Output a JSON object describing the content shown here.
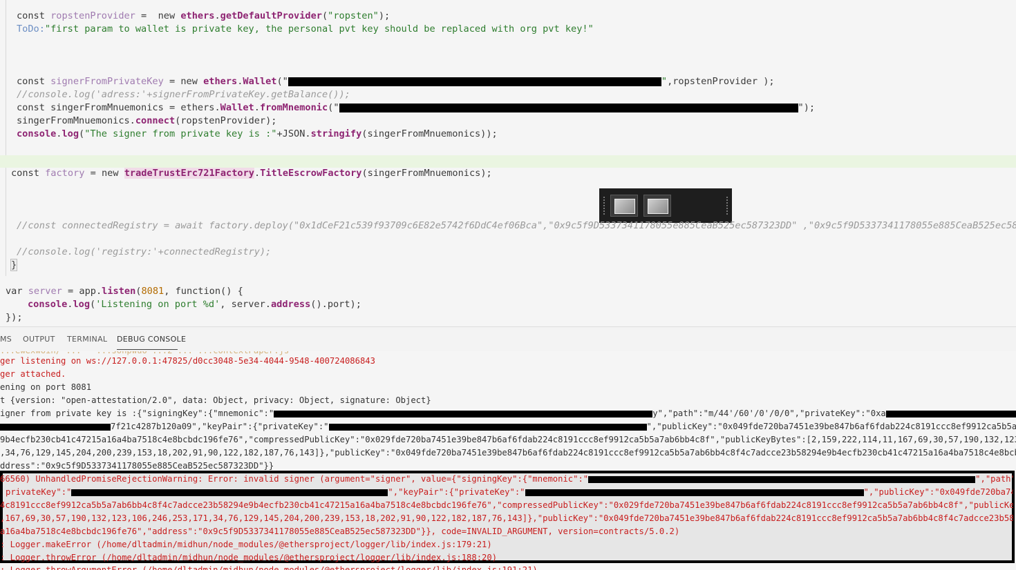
{
  "editor": {
    "line1": {
      "pre": "const ",
      "ident": "ropstenProvider",
      "mid": " =  new ",
      "obj": "ethers",
      "dot": ".",
      "fn": "getDefaultProvider",
      "open": "(",
      "str": "\"ropsten\"",
      "close": ");"
    },
    "line2": {
      "todo": "ToDo:",
      "str": "\"first param to wallet is private key, the personal pvt key should be replaced with org pvt key!\""
    },
    "line5": {
      "pre": "const ",
      "ident": "signerFromPrivateKey",
      "mid": " = new ",
      "obj": "ethers",
      "dot": ".",
      "fn": "Wallet",
      "open": "(\"",
      "str_end": "\"",
      "rest": ",ropstenProvider );"
    },
    "line6": {
      "cmt": "//console.log('adress:'+signerFromPrivateKey.getBalance());"
    },
    "line7": {
      "pre": "const singerFromMnuemonics = ethers.",
      "fn1": "Wallet",
      "dot": ".",
      "fn2": "fromMnemonic",
      "open": "(\"",
      "close": "\");"
    },
    "line8": {
      "pre": "singerFromMnuemonics.",
      "fn": "connect",
      "rest": "(ropstenProvider);"
    },
    "line9": {
      "obj": "console",
      "dot": ".",
      "fn": "log",
      "open": "(",
      "str": "\"The signer from private key is :\"",
      "mid": "+JSON.",
      "fn2": "stringify",
      "rest": "(singerFromMnuemonics));"
    },
    "line12": {
      "pre": "const ",
      "ident": "factory",
      "mid": " = new ",
      "hl": "tradeTrustErc721Factory",
      "dot": ".",
      "fn": "TitleEscrowFactory",
      "rest": "(singerFromMnuemonics);"
    },
    "line15": {
      "cmt": "//const connectedRegistry = await factory.deploy(\"0x1dCeF21c539f93709c6E82e5742f6DdC4ef06Bca\",\"0x9c5f9D5337341178055e885CeaB525ec587323DD\" ,\"0x9c5f9D5337341178055e885CeaB525ec587323DD\")"
    },
    "line17": {
      "cmt": "//console.log('registry:'+connectedRegistry);"
    },
    "line18": {
      "brace": "}"
    },
    "line19": {
      "pre": "var ",
      "ident": "server",
      "mid": " = app.",
      "fn": "listen",
      "open": "(",
      "num": "8081",
      "rest": ", function() {"
    },
    "line20": {
      "obj": "console",
      "dot": ".",
      "fn": "log",
      "open": "(",
      "str": "'Listening on port %d'",
      "mid": ", server.",
      "fn2": "address",
      "rest": "().port);"
    },
    "line21": {
      "text": "});"
    }
  },
  "panel": {
    "tabs": [
      "MS",
      "OUTPUT",
      "TERMINAL",
      "DEBUG CONSOLE"
    ],
    "active_tab": "DEBUG CONSOLE"
  },
  "console": {
    "top_partial": "...ewexwoin/ ...   ...sonpwuo ...2 ... ...contextPaper.js",
    "l1": "ger listening on ws://127.0.0.1:47825/d0cc3048-5e34-4044-9548-400724086843",
    "l2": "ger attached.",
    "l3": "ening on port 8081",
    "l4": "t {version: \"open-attestation/2.0\", data: Object, privacy: Object, signature: Object}",
    "l5a": "igner from private key is :{\"signingKey\":{\"mnemonic\":\"",
    "l5b": "y\",\"path\":\"m/44'/60'/0'/0/0\",\"privateKey\":\"0xa",
    "l6a": "7f21c4287b120a09\",\"keyPair\":{\"privateKey\":\"",
    "l6b": "\",\"publicKey\":\"0x049fde720ba7451e39be847b6af6fdab224c8191ccc8ef9912ca5b5a7ab6bb4c8f4c7adcce23",
    "l7": "9b4ecfb230cb41c47215a16a4ba7518c4e8bcbdc196fe76\",\"compressedPublicKey\":\"0x029fde720ba7451e39be847b6af6fdab224c8191ccc8ef9912ca5b5a7ab6bb4c8f\",\"publicKeyBytes\":[2,159,222,114,11,167,69,30,57,190,132,123,106,246,",
    "l8": ",34,76,129,145,204,200,239,153,18,202,91,90,122,182,187,76,143]},\"publicKey\":\"0x049fde720ba7451e39be847b6af6fdab224c8191ccc8ef9912ca5b5a7ab6bb4c8f4c7adcce23b58294e9b4ecfb230cb41c47215a16a4ba7518c4e8bcbdc196fe7",
    "l9": "ddress\":\"0x9c5f9D5337341178055e885CeaB525ec587323DD\"}}",
    "e1a": "66560) UnhandledPromiseRejectionWarning: Error: invalid signer (argument=\"signer\", value={\"signingKey\":{\"mnemonic\":\"",
    "e1b": "\",\"path\":\"m/44",
    "e2a": "privateKey\":\"",
    "e2b": "\",\"keyPair\":{\"privateKey\":\"",
    "e2c": "\",\"publicKey\":\"0x049fde720ba7451e39be",
    "e3": "4c8191ccc8ef9912ca5b5a7ab6bb4c8f4c7adcce23b58294e9b4ecfb230cb41c47215a16a4ba7518c4e8bcbdc196fe76\",\"compressedPublicKey\":\"0x029fde720ba7451e39be847b6af6fdab224c8191ccc8ef9912ca5b5a7ab6bb4c8f\",\"publicKeyBytes\":[2",
    "e4": ",167,69,30,57,190,132,123,106,246,253,171,34,76,129,145,204,200,239,153,18,202,91,90,122,182,187,76,143]},\"publicKey\":\"0x049fde720ba7451e39be847b6af6fdab224c8191ccc8ef9912ca5b5a7ab6bb4c8f4c7adcce23b58294e9b4e",
    "e5": "a16a4ba7518c4e8bcbdc196fe76\",\"address\":\"0x9c5f9D5337341178055e885CeaB525ec587323DD\"}}, code=INVALID_ARGUMENT, version=contracts/5.0.2)",
    "e6": ": Logger.makeError (/home/dltadmin/midhun/node_modules/@ethersproject/logger/lib/index.js:179:21)",
    "e7": ": Logger.throwError (/home/dltadmin/midhun/node_modules/@ethersproject/logger/lib/index.js:188:20)",
    "e8": ": Logger.throwArgumentError (/home/dltadmin/midhun/node_modules/@ethersproject/logger/lib/index.js:191:21)"
  }
}
